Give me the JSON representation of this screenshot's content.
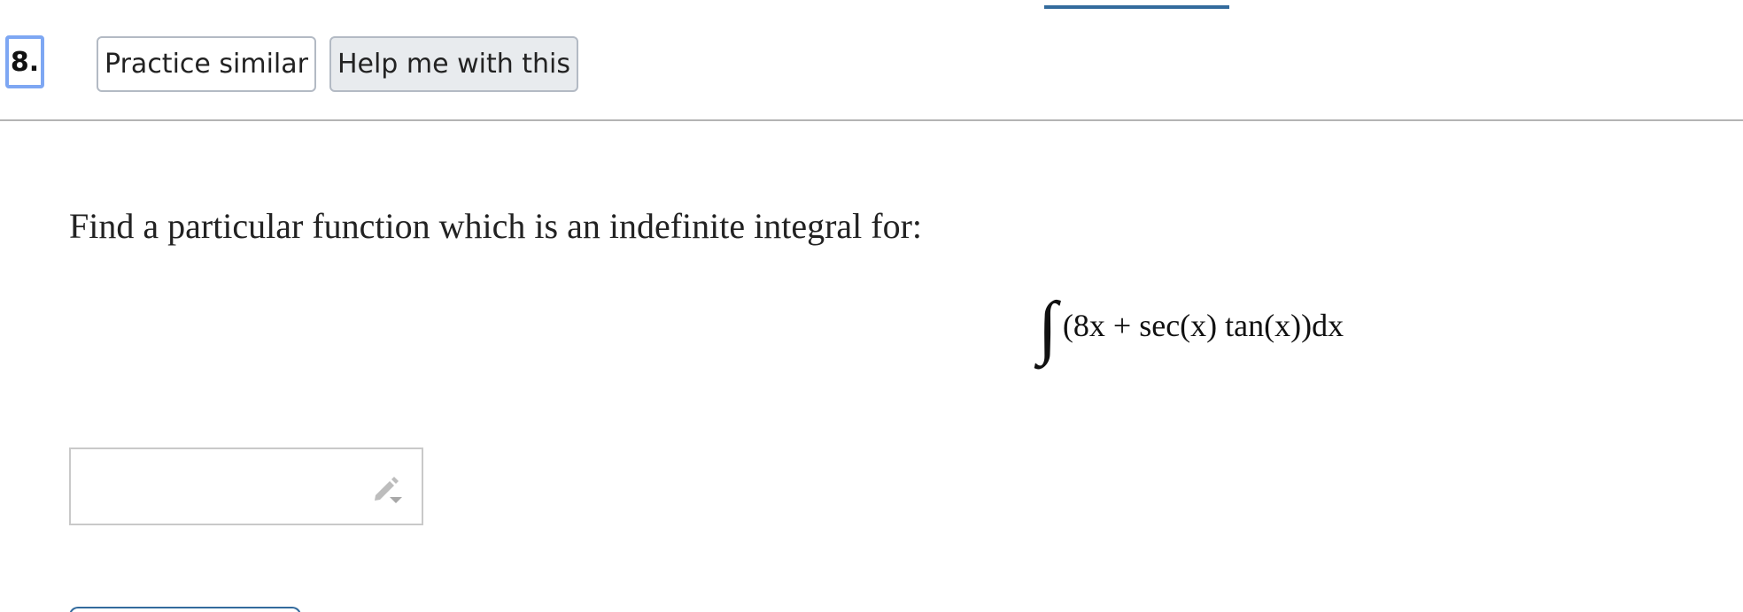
{
  "question": {
    "number": "8.",
    "practice_label": "Practice similar",
    "help_label": "Help me with this"
  },
  "problem": {
    "prompt": "Find a particular function which is an indefinite integral for:",
    "integrand": "(8x + sec(x) tan(x))dx",
    "integral_symbol": "∫"
  },
  "answer": {
    "value": "",
    "editor_icon": "pencil-dropdown-icon"
  },
  "colors": {
    "accent": "#336b9d",
    "focus_ring": "#7ea7f3"
  }
}
